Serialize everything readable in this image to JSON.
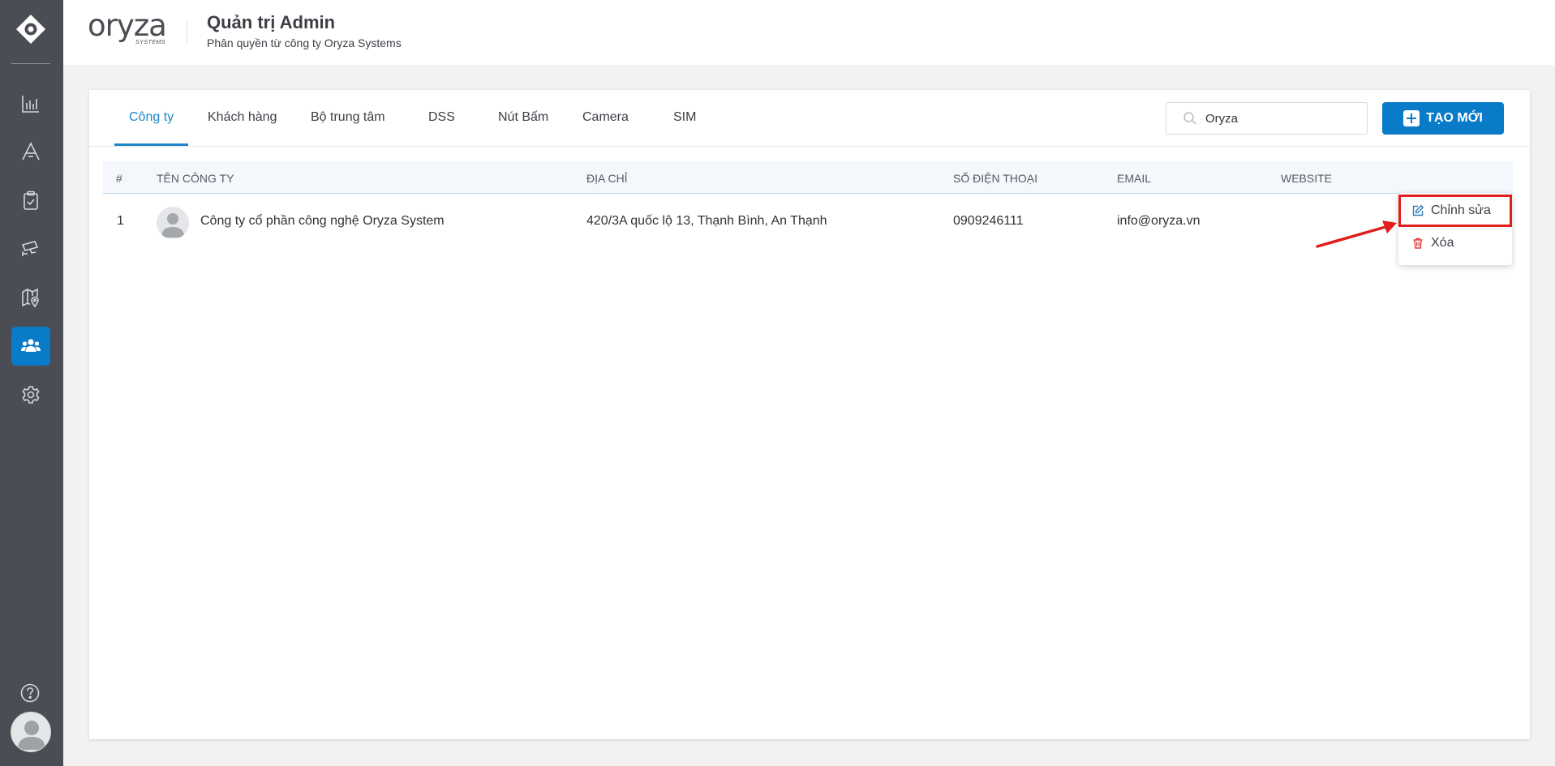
{
  "brand": {
    "name": "oryza",
    "sub": "SYSTEMS"
  },
  "header": {
    "title": "Quản trị Admin",
    "subtitle": "Phân quyền từ công ty Oryza Systems"
  },
  "sidebar": {
    "items": [
      {
        "icon": "bar-chart-icon",
        "active": false
      },
      {
        "icon": "font-icon",
        "active": false
      },
      {
        "icon": "clipboard-check-icon",
        "active": false
      },
      {
        "icon": "cctv-camera-icon",
        "active": false
      },
      {
        "icon": "map-marker-icon",
        "active": false
      },
      {
        "icon": "users-icon",
        "active": true
      },
      {
        "icon": "gear-icon",
        "active": false
      }
    ]
  },
  "tabs": [
    {
      "label": "Công ty",
      "active": true
    },
    {
      "label": "Khách hàng",
      "active": false
    },
    {
      "label": "Bộ trung tâm",
      "active": false
    },
    {
      "label": "DSS",
      "active": false
    },
    {
      "label": "Nút Bấm",
      "active": false
    },
    {
      "label": "Camera",
      "active": false
    },
    {
      "label": "SIM",
      "active": false
    }
  ],
  "search": {
    "value": "Oryza",
    "placeholder": ""
  },
  "create_button": {
    "label": "TẠO MỚI"
  },
  "table": {
    "columns": [
      "#",
      "TÊN CÔNG TY",
      "ĐỊA CHỈ",
      "SỐ ĐIỆN THOẠI",
      "EMAIL",
      "WEBSITE"
    ],
    "rows": [
      {
        "index": "1",
        "name": "Công ty cổ phần công nghệ Oryza System",
        "address": "420/3A quốc lộ 13, Thạnh Bình, An Thạnh",
        "phone": "0909246111",
        "email": "info@oryza.vn",
        "website": ""
      }
    ]
  },
  "context_menu": {
    "edit_label": "Chỉnh sửa",
    "delete_label": "Xóa"
  },
  "colors": {
    "sidebar_bg": "#4a4e54",
    "accent": "#0a7bc9",
    "highlight": "#e01e1e"
  }
}
